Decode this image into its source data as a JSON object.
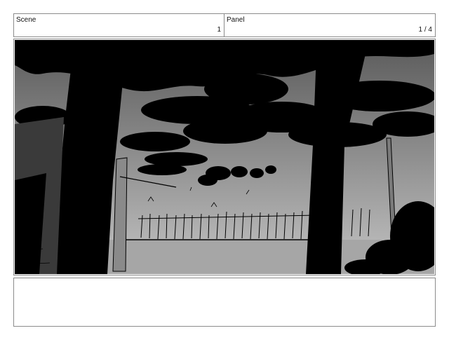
{
  "header": {
    "scene_label": "Scene",
    "scene_value": "1",
    "panel_label": "Panel",
    "panel_value": "1 / 4"
  },
  "frame": {
    "sky_top_color": "#5a5a5a",
    "sky_bottom_color": "#c4c4c4",
    "ink_color": "#000000"
  },
  "notes": {
    "text": ""
  }
}
